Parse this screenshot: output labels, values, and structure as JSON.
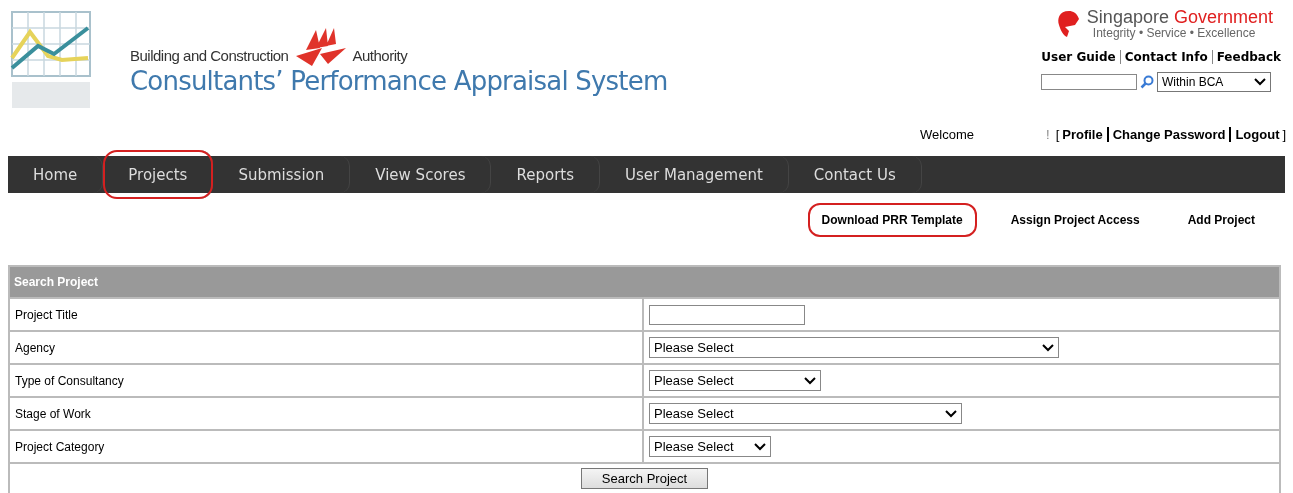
{
  "header": {
    "agency_name_left": "Building and Construction",
    "agency_name_right": "Authority",
    "system_title": "Consultants’ Performance Appraisal System",
    "gov_name_a": "Singapore",
    "gov_name_b": "Government",
    "gov_motto": "Integrity • Service • Excellence",
    "top_links": [
      "User Guide",
      "Contact Info",
      "Feedback"
    ],
    "search_scope": "Within BCA"
  },
  "user_bar": {
    "welcome": "Welcome",
    "exclaim": "!",
    "bracket_open": "[",
    "bracket_close": "]",
    "links": [
      "Profile",
      "Change Password",
      "Logout"
    ]
  },
  "nav": [
    {
      "label": "Home",
      "highlighted": false
    },
    {
      "label": "Projects",
      "highlighted": true
    },
    {
      "label": "Submission",
      "highlighted": false
    },
    {
      "label": "View Scores",
      "highlighted": false
    },
    {
      "label": "Reports",
      "highlighted": false
    },
    {
      "label": "User Management",
      "highlighted": false
    },
    {
      "label": "Contact Us",
      "highlighted": false
    }
  ],
  "sub_nav": [
    {
      "label": "Download PRR Template",
      "highlighted": true
    },
    {
      "label": "Assign Project Access",
      "highlighted": false
    },
    {
      "label": "Add Project",
      "highlighted": false
    }
  ],
  "search_form": {
    "title": "Search Project",
    "fields": [
      {
        "label": "Project Title",
        "kind": "text"
      },
      {
        "label": "Agency",
        "kind": "select",
        "value": "Please Select"
      },
      {
        "label": "Type of Consultancy",
        "kind": "select",
        "value": "Please Select"
      },
      {
        "label": "Stage of Work",
        "kind": "select",
        "value": "Please Select"
      },
      {
        "label": "Project Category",
        "kind": "select",
        "value": "Please Select"
      }
    ],
    "button": "Search Project"
  }
}
